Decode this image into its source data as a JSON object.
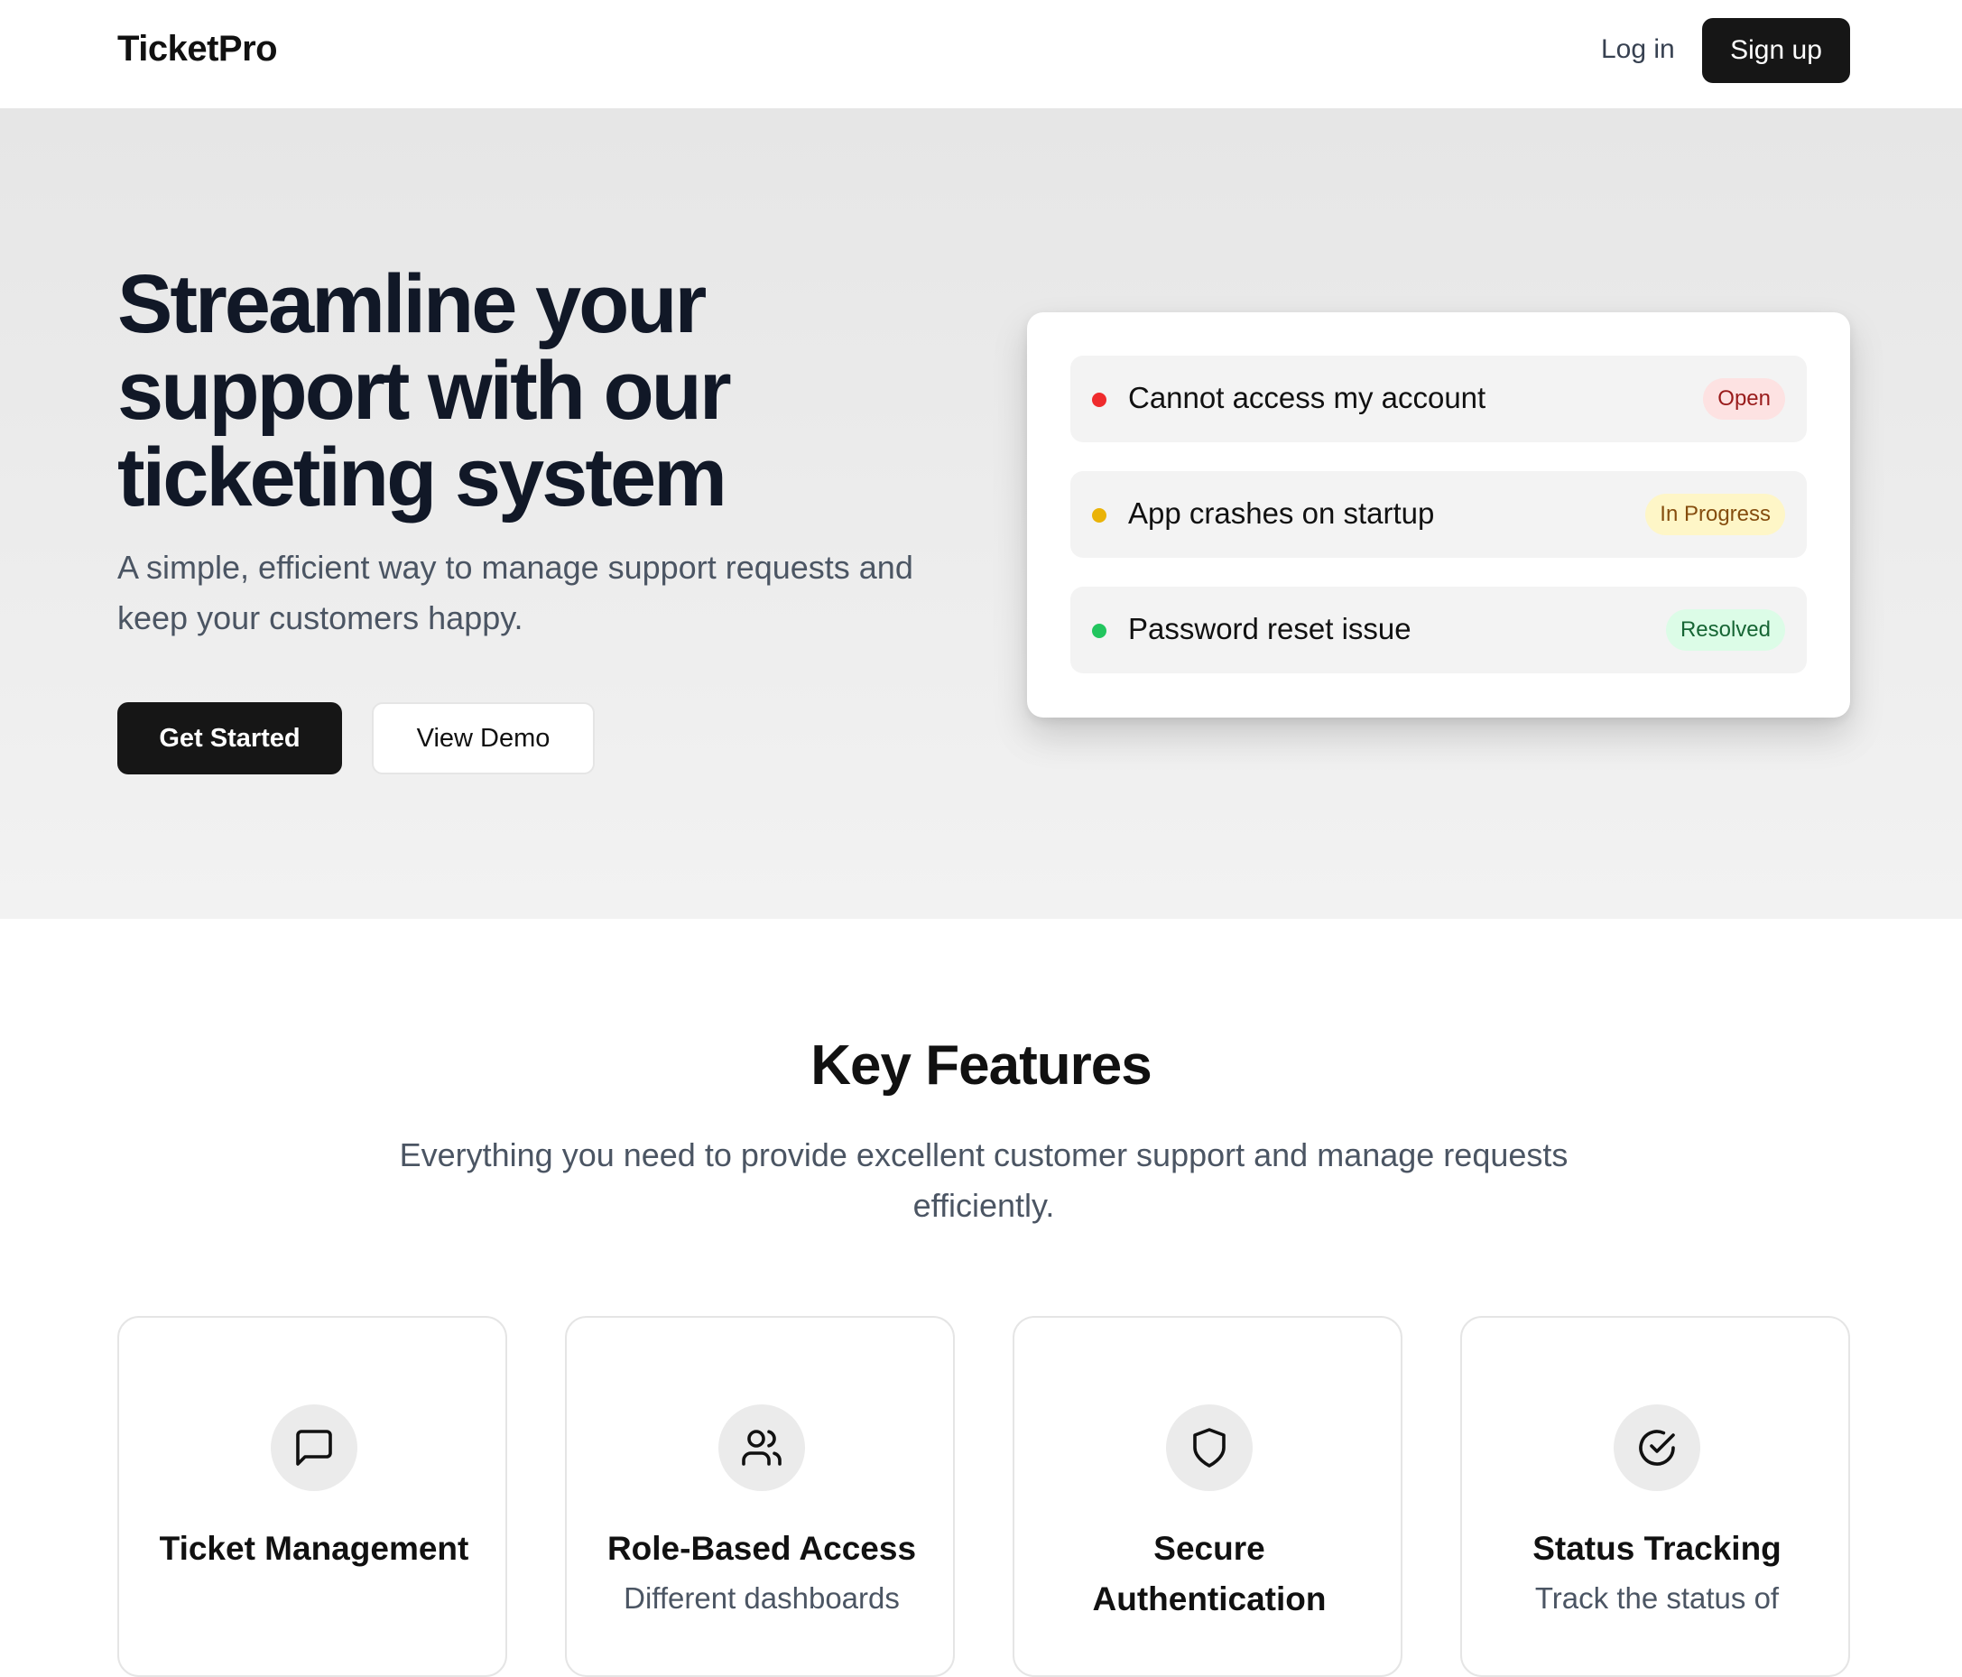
{
  "header": {
    "logo": "TicketPro",
    "login_label": "Log in",
    "signup_label": "Sign up"
  },
  "hero": {
    "title": "Streamline your support with our ticketing system",
    "subtitle": "A simple, efficient way to manage support requests and keep your customers happy.",
    "primary_label": "Get Started",
    "secondary_label": "View Demo"
  },
  "tickets": [
    {
      "title": "Cannot access my account",
      "status": "Open",
      "dot_color": "#ef2b2d",
      "badge_bg": "#fde2e2",
      "badge_fg": "#991b1b"
    },
    {
      "title": "App crashes on startup",
      "status": "In Progress",
      "dot_color": "#eab308",
      "badge_bg": "#fef6c7",
      "badge_fg": "#854d0e"
    },
    {
      "title": "Password reset issue",
      "status": "Resolved",
      "dot_color": "#22c55e",
      "badge_bg": "#dcfce7",
      "badge_fg": "#166534"
    }
  ],
  "features": {
    "title": "Key Features",
    "subtitle": "Everything you need to provide excellent customer support and manage requests efficiently.",
    "cards": [
      {
        "icon": "message-square-icon",
        "title": "Ticket Management",
        "desc": ""
      },
      {
        "icon": "users-icon",
        "title": "Role-Based Access",
        "desc": "Different dashboards"
      },
      {
        "icon": "shield-icon",
        "title": "Secure Authentication",
        "desc": ""
      },
      {
        "icon": "check-circle-icon",
        "title": "Status Tracking",
        "desc": "Track the status of"
      }
    ]
  }
}
